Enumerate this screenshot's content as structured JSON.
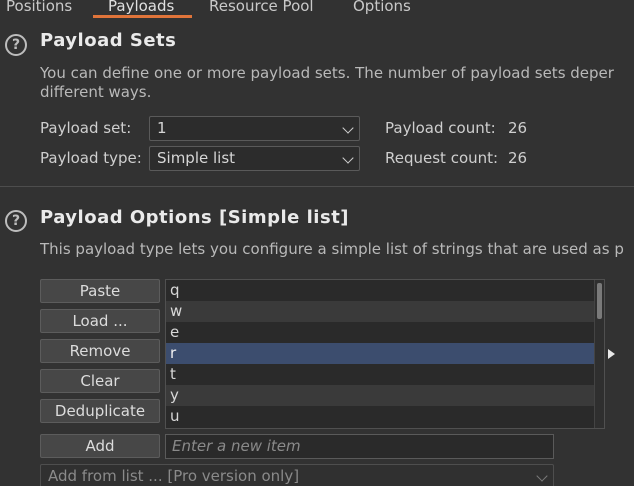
{
  "tabs": [
    {
      "label": "Positions",
      "active": false
    },
    {
      "label": "Payloads",
      "active": true
    },
    {
      "label": "Resource Pool",
      "active": false
    },
    {
      "label": "Options",
      "active": false
    }
  ],
  "help_glyph": "?",
  "payload_sets": {
    "title": "Payload Sets",
    "description_line1": "You can define one or more payload sets. The number of payload sets deper",
    "description_line2": "different ways.",
    "payload_set_label": "Payload set:",
    "payload_set_value": "1",
    "payload_type_label": "Payload type:",
    "payload_type_value": "Simple list",
    "payload_count_label": "Payload count:",
    "payload_count_value": "26",
    "request_count_label": "Request count:",
    "request_count_value": "26"
  },
  "payload_options": {
    "title": "Payload Options [Simple list]",
    "description": "This payload type lets you configure a simple list of strings that are used as p",
    "buttons": {
      "paste": "Paste",
      "load": "Load ...",
      "remove": "Remove",
      "clear": "Clear",
      "deduplicate": "Deduplicate",
      "add": "Add"
    },
    "list_items": [
      "q",
      "w",
      "e",
      "r",
      "t",
      "y",
      "u"
    ],
    "selected_item": "r",
    "new_item_placeholder": "Enter a new item",
    "add_from_list_value": "Add from list ... [Pro version only]"
  },
  "colors": {
    "accent": "#e0743a",
    "selection": "#3c4d6e",
    "background": "#323232"
  },
  "icons": [
    "help-icon",
    "chevron-down-icon",
    "play-arrow-icon"
  ]
}
